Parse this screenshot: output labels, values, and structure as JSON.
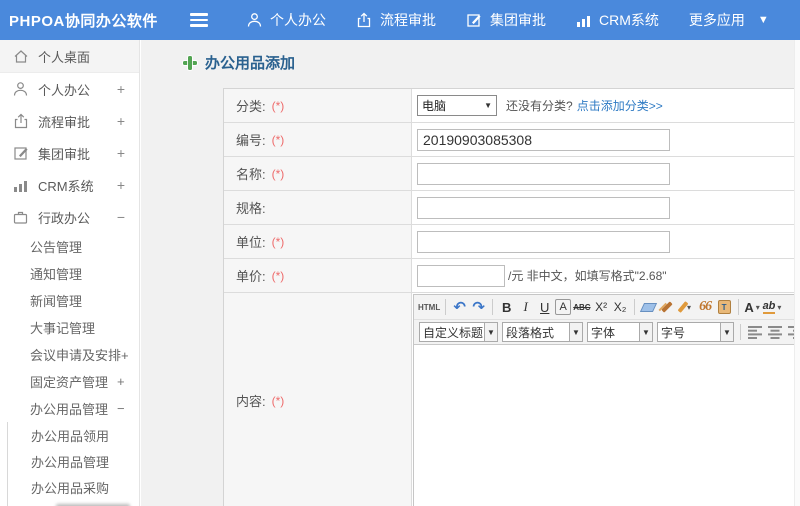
{
  "colors": {
    "topbar_bg": "#4a89dc",
    "title_text": "#2a618f",
    "required_red": "#ee6b6b",
    "link_blue": "#2f7bc4",
    "add_icon_green": "#52a452"
  },
  "icons": {
    "hamburger-icon": "three-bars",
    "person-icon": "person outline",
    "upload-icon": "arrow-up from tray",
    "edit-icon": "pencil on square",
    "chart-icon": "bar chart",
    "home-icon": "house outline",
    "briefcase-icon": "briefcase outline",
    "caret-down-icon": "▾",
    "select-caret-icon": "▼",
    "add-icon": "green plus"
  },
  "topbar": {
    "logo": "PHPOA协同办公软件",
    "nav": [
      {
        "label": "个人办公"
      },
      {
        "label": "流程审批"
      },
      {
        "label": "集团审批"
      },
      {
        "label": "CRM系统"
      },
      {
        "label": "更多应用"
      }
    ]
  },
  "sidebar": {
    "items": [
      {
        "label": "个人桌面"
      },
      {
        "label": "个人办公",
        "expander": "+"
      },
      {
        "label": "流程审批",
        "expander": "+"
      },
      {
        "label": "集团审批",
        "expander": "+"
      },
      {
        "label": "CRM系统",
        "expander": "+"
      },
      {
        "label": "行政办公",
        "expander": "−"
      }
    ],
    "submenu": [
      {
        "label": "公告管理"
      },
      {
        "label": "通知管理"
      },
      {
        "label": "新闻管理"
      },
      {
        "label": "大事记管理"
      },
      {
        "label": "会议申请及安排+"
      },
      {
        "label": "固定资产管理",
        "expander": "+"
      },
      {
        "label": "办公用品管理",
        "expander": "−"
      }
    ],
    "subsubmenu": [
      {
        "label": "办公用品领用"
      },
      {
        "label": "办公用品管理"
      },
      {
        "label": "办公用品采购"
      }
    ]
  },
  "main": {
    "title": "办公用品添加",
    "form": {
      "category": {
        "label": "分类:",
        "required": "(*)",
        "select_value": "电脑",
        "hint": "还没有分类?",
        "link": "点击添加分类>>"
      },
      "code": {
        "label": "编号:",
        "required": "(*)",
        "value": "20190903085308"
      },
      "name": {
        "label": "名称:",
        "required": "(*)"
      },
      "spec": {
        "label": "规格:"
      },
      "unit": {
        "label": "单位:",
        "required": "(*)"
      },
      "price": {
        "label": "单价:",
        "required": "(*)",
        "hint": "/元 非中文，如填写格式\"2.68\""
      },
      "content": {
        "label": "内容:",
        "required": "(*)"
      }
    },
    "editor": {
      "html_button": "HTML",
      "bold": "B",
      "italic": "I",
      "underline": "U",
      "font_box": "A",
      "strike": "ABC",
      "superscript": "X²",
      "subscript": "X₂",
      "quote": "66",
      "paste_table": "T",
      "font_color": "A",
      "highlight": "ab",
      "heading_select": "自定义标题",
      "paragraph_select": "段落格式",
      "font_select": "字体",
      "size_select": "字号"
    }
  }
}
